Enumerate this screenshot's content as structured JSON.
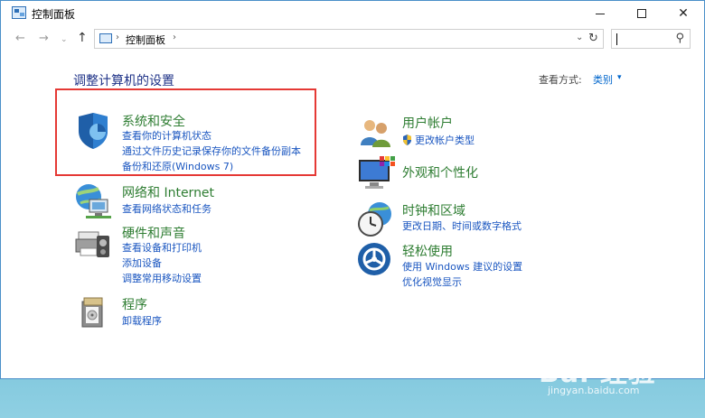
{
  "window": {
    "title": "控制面板",
    "min_label": "",
    "close_label": "✕"
  },
  "nav": {
    "back": "←",
    "forward": "→",
    "recent": "⌄",
    "up": "↑",
    "address_path": "控制面板",
    "address_sep": "›",
    "dropdown": "⌄",
    "refresh": "↻",
    "search_icon": "⚲"
  },
  "main": {
    "heading": "调整计算机的设置",
    "view_by_label": "查看方式:",
    "view_by_value": "类别",
    "view_by_arrow": "▾"
  },
  "categories": [
    {
      "title": "系统和安全",
      "icon": "shield-icon",
      "links": [
        "查看你的计算机状态",
        "通过文件历史记录保存你的文件备份副本",
        "备份和还原(Windows 7)"
      ]
    },
    {
      "title": "网络和 Internet",
      "icon": "network-globe-icon",
      "links": [
        "查看网络状态和任务"
      ]
    },
    {
      "title": "硬件和声音",
      "icon": "printer-icon",
      "links": [
        "查看设备和打印机",
        "添加设备",
        "调整常用移动设置"
      ]
    },
    {
      "title": "程序",
      "icon": "programs-icon",
      "links": [
        "卸载程序"
      ]
    },
    {
      "title": "用户帐户",
      "icon": "users-icon",
      "links": [
        "更改帐户类型"
      ]
    },
    {
      "title": "外观和个性化",
      "icon": "monitor-palette-icon",
      "links": []
    },
    {
      "title": "时钟和区域",
      "icon": "clock-globe-icon",
      "links": [
        "更改日期、时间或数字格式"
      ]
    },
    {
      "title": "轻松使用",
      "icon": "ease-of-access-icon",
      "links": [
        "使用 Windows 建议的设置",
        "优化视觉显示"
      ]
    }
  ],
  "watermark": {
    "logo": "Bai 经验",
    "url": "jingyan.baidu.com"
  },
  "colors": {
    "heading": "#1e3287",
    "category_title": "#2e7d32",
    "link": "#1a56c0",
    "highlight_border": "#e53935"
  }
}
